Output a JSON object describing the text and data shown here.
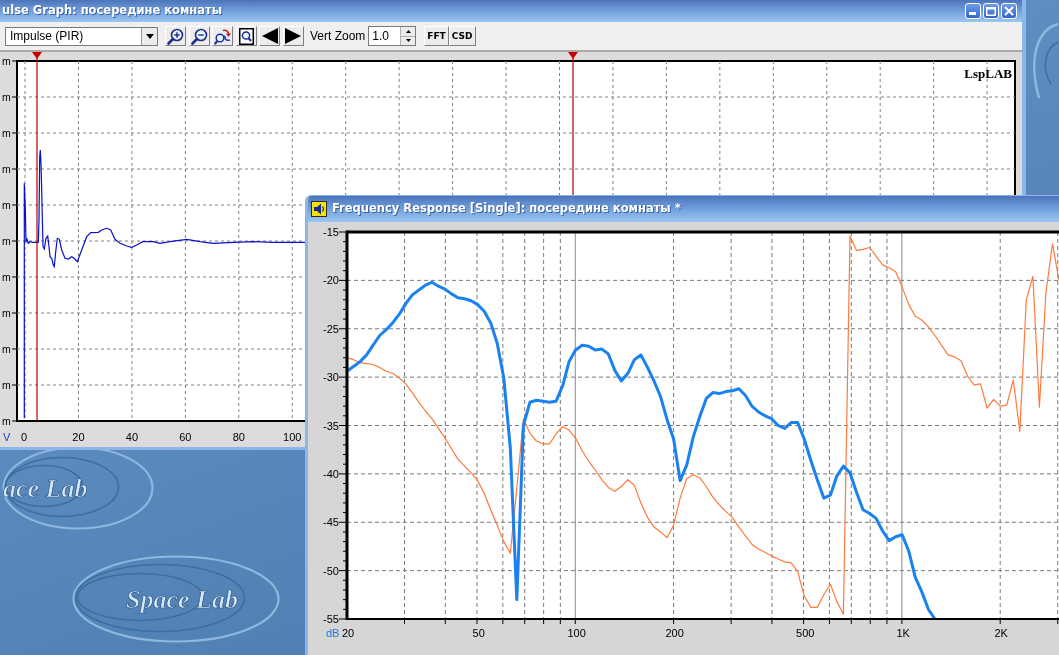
{
  "desktop": {
    "logos": [
      {
        "text": "ace Lab"
      },
      {
        "text": "Space Lab"
      }
    ]
  },
  "impulse_window": {
    "title": "ulse Graph: посередине комнаты",
    "toolbar": {
      "dropdown": {
        "value": "Impulse (PIR)"
      },
      "vert_zoom": {
        "label": "Vert Zoom",
        "value": "1.0"
      },
      "buttons": [
        "FFT",
        "CSD"
      ]
    },
    "graph": {
      "y_labels": [
        "m",
        "m",
        "m",
        "m",
        "m",
        "m",
        "m",
        "m",
        "m",
        "m",
        "m"
      ],
      "x_labels": [
        "0",
        "20",
        "40",
        "60",
        "80",
        "100"
      ],
      "unit": "V",
      "logo_text": "LspLAB"
    }
  },
  "frequency_window": {
    "title": "Frequency Response [Single]: посередине комнаты *",
    "chart_data": {
      "type": "line",
      "ylabel": "dB",
      "grid": true,
      "ylim": [
        -55,
        -15
      ],
      "yticks": [
        -15,
        -20,
        -25,
        -30,
        -35,
        -40,
        -45,
        -50,
        -55
      ],
      "categories": [
        "20",
        null,
        null,
        null,
        null,
        null,
        null,
        null,
        null,
        null,
        null,
        null,
        null,
        null,
        null,
        null,
        null,
        null,
        null,
        null,
        "50",
        null,
        null,
        null,
        null,
        null,
        null,
        null,
        null,
        null,
        null,
        null,
        null,
        null,
        null,
        "100",
        null,
        null,
        null,
        null,
        null,
        null,
        null,
        null,
        null,
        null,
        null,
        null,
        null,
        null,
        "200",
        null,
        null,
        null,
        null,
        null,
        null,
        null,
        null,
        null,
        null,
        null,
        null,
        null,
        null,
        null,
        null,
        null,
        null,
        null,
        "500",
        null,
        null,
        null,
        null,
        null,
        null,
        null,
        null,
        null,
        null,
        null,
        null,
        null,
        null,
        "1K",
        null,
        null,
        null,
        null,
        null,
        null,
        null,
        null,
        null,
        null,
        null,
        null,
        null,
        null,
        "2K",
        null,
        null,
        null,
        null,
        null,
        null,
        null,
        null,
        null
      ],
      "series": [
        {
          "color": "#1a82f0",
          "values": [
            -29.4,
            -28.9,
            -28.4,
            -27.7,
            -26.7,
            -25.7,
            -25.1,
            -24.4,
            -23.5,
            -22.4,
            -21.5,
            -21.0,
            -20.5,
            -20.2,
            -20.6,
            -20.9,
            -21.4,
            -21.8,
            -21.9,
            -22.1,
            -22.5,
            -23.2,
            -24.4,
            -26.5,
            -30.1,
            -37.3,
            -53.0,
            -35.0,
            -32.6,
            -32.4,
            -32.5,
            -32.6,
            -32.5,
            -30.9,
            -28.4,
            -27.2,
            -26.7,
            -26.8,
            -27.2,
            -27.1,
            -27.6,
            -29.3,
            -30.4,
            -29.6,
            -28.2,
            -27.7,
            -29.0,
            -30.4,
            -32.0,
            -34.4,
            -36.4,
            -40.7,
            -39.1,
            -36.2,
            -34.1,
            -32.2,
            -31.6,
            -31.7,
            -31.5,
            -31.4,
            -31.2,
            -31.9,
            -33.0,
            -33.6,
            -34.0,
            -34.3,
            -35.0,
            -35.3,
            -34.7,
            -34.7,
            -36.4,
            -38.6,
            -40.6,
            -42.5,
            -42.2,
            -40.2,
            -39.2,
            -39.9,
            -41.9,
            -43.7,
            -44.1,
            -44.6,
            -45.9,
            -46.9,
            -46.5,
            -46.3,
            -48.0,
            -50.7,
            -52.2,
            -54.0,
            -55.0,
            null,
            null,
            null,
            null,
            null,
            null,
            null,
            null,
            null,
            null,
            null,
            null,
            null,
            null,
            null,
            null,
            null,
            null,
            null
          ]
        },
        {
          "color": "#ff7a3c",
          "values": [
            -28.0,
            -28.2,
            -28.5,
            -28.6,
            -28.7,
            -29.0,
            -29.4,
            -29.6,
            -30.1,
            -30.7,
            -31.6,
            -32.6,
            -33.5,
            -34.3,
            -35.3,
            -36.3,
            -37.4,
            -38.5,
            -39.2,
            -39.9,
            -40.7,
            -42.0,
            -43.7,
            -45.3,
            -47.0,
            -48.2,
            -41.5,
            -34.3,
            -35.8,
            -36.6,
            -36.9,
            -36.9,
            -35.9,
            -35.1,
            -35.5,
            -36.3,
            -37.6,
            -38.7,
            -39.6,
            -40.6,
            -41.4,
            -41.8,
            -41.3,
            -40.6,
            -41.2,
            -43.0,
            -44.5,
            -45.5,
            -46.0,
            -46.6,
            -45.3,
            -42.5,
            -40.5,
            -40.1,
            -40.4,
            -41.3,
            -42.4,
            -43.2,
            -43.9,
            -44.5,
            -45.5,
            -46.4,
            -47.3,
            -47.8,
            -48.1,
            -48.5,
            -48.8,
            -49.1,
            -49.2,
            -50.1,
            -52.6,
            -53.8,
            -53.8,
            -52.5,
            -51.4,
            -53.2,
            -54.5,
            -15.4,
            -16.9,
            -16.8,
            -16.6,
            -17.5,
            -18.4,
            -18.7,
            -19.1,
            -20.7,
            -22.5,
            -23.7,
            -24.1,
            -24.8,
            -25.7,
            -26.7,
            -27.7,
            -27.9,
            -28.3,
            -29.9,
            -30.8,
            -30.7,
            -33.2,
            -32.3,
            -33.0,
            -32.9,
            -30.3,
            -35.6,
            -22.0,
            -19.6,
            -33.1,
            -21.3,
            -16.2,
            -20.0
          ]
        }
      ]
    }
  }
}
